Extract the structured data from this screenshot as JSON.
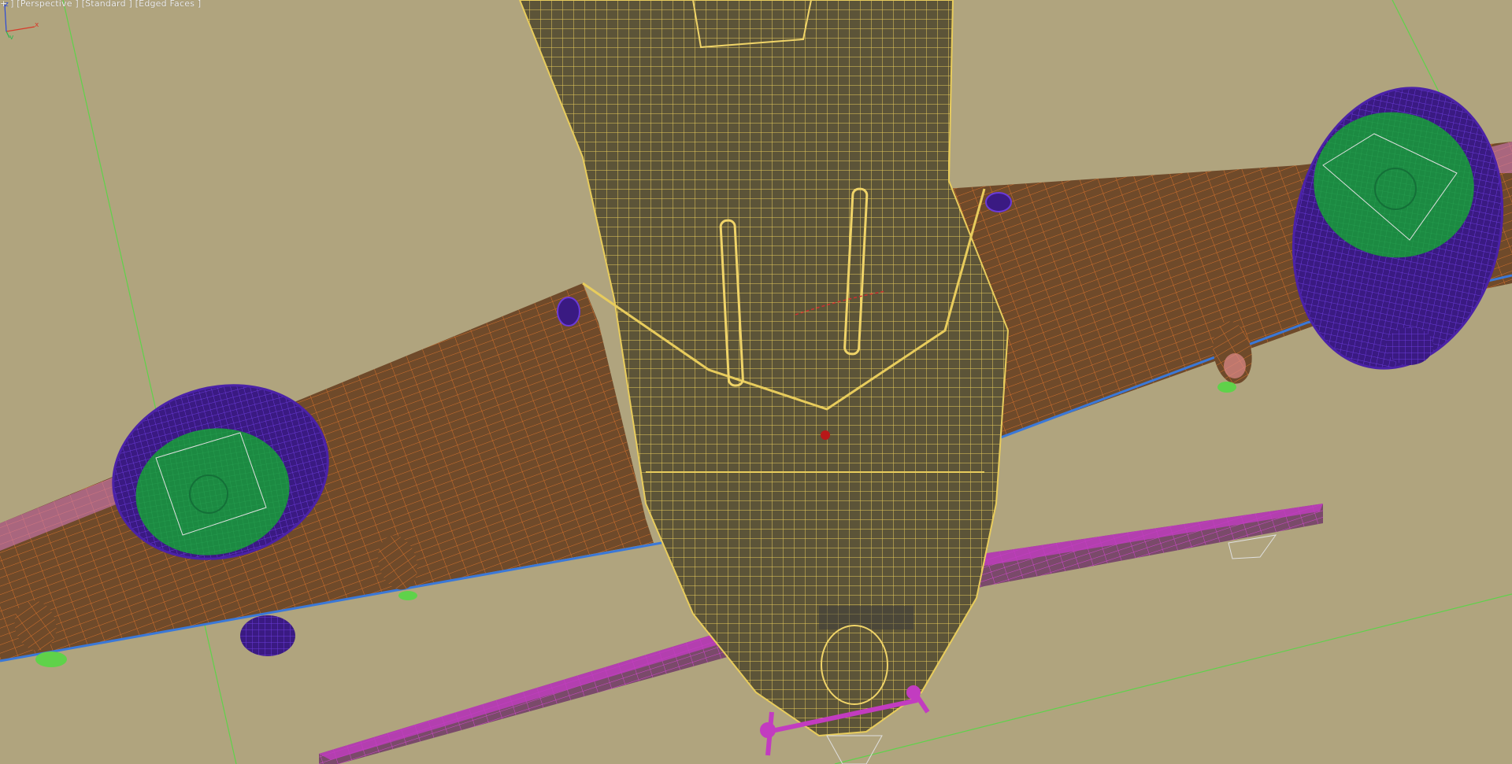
{
  "viewport": {
    "label_plus": "+",
    "label_view": "Perspective",
    "label_shading": "Standard",
    "label_mode": "Edged Faces",
    "background_color": "#b0a47e"
  },
  "scene": {
    "fuselage_color": "#e6c85a",
    "wing_color": "#c8662a",
    "nacelle_color": "#4b22a8",
    "fan_color": "#1f8f45",
    "stabilizer_color": "#c23cc0",
    "grid_color": "#5fd24a"
  },
  "axis_tripod": {
    "x_label": "x",
    "y_label": "y",
    "z_label": "z",
    "icon": "axis-tripod-icon"
  }
}
